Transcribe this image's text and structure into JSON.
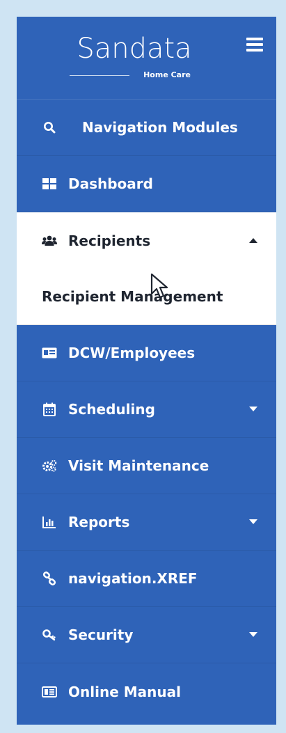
{
  "logo": {
    "name": "Sandata",
    "subtitle": "Home Care"
  },
  "menu": {
    "search_label": "Navigation Modules",
    "dashboard": "Dashboard",
    "recipients": "Recipients",
    "recipient_management": "Recipient Management",
    "dcw_employees": "DCW/Employees",
    "scheduling": "Scheduling",
    "visit_maintenance": "Visit Maintenance",
    "reports": "Reports",
    "navigation_xref": "navigation.XREF",
    "security": "Security",
    "online_manual": "Online Manual"
  },
  "colors": {
    "sidebar": "#2f63b8",
    "active": "#ffffff",
    "page_bg": "#cfe4f3"
  },
  "icons": [
    "hamburger-icon",
    "search-icon",
    "dashboard-icon",
    "users-icon",
    "id-card-icon",
    "calendar-icon",
    "gears-icon",
    "bar-chart-icon",
    "link-icon",
    "key-icon",
    "manual-icon"
  ]
}
